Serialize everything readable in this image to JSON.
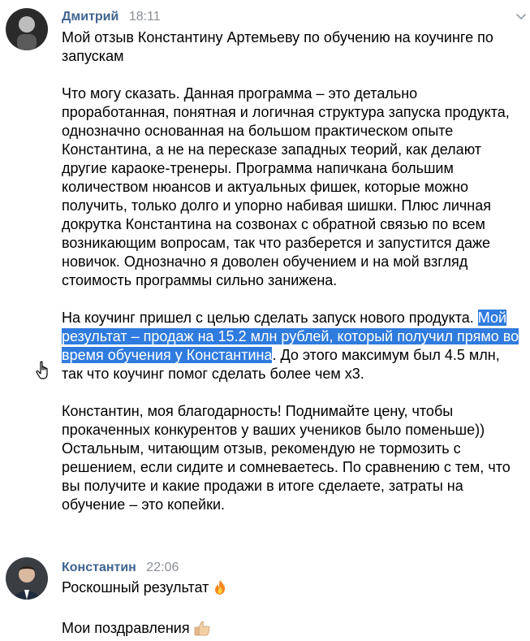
{
  "messages": [
    {
      "author": "Дмитрий",
      "time": "18:11",
      "avatar_icon": "user-photo-dmitry",
      "title_lines": [
        "Мой отзыв Константину Артемьеву по обучению на коучинге по",
        "запускам"
      ],
      "p1_lines": [
        "Что могу сказать. Данная программа – это детально",
        "проработанная, понятная и логичная структура запуска продукта,",
        "однозначно основанная на большом практическом опыте",
        "Константина, а не на пересказе западных теорий, как делают",
        "другие караоке-тренеры. Программа напичкана большим",
        "количеством нюансов и актуальных фишек, которые можно",
        "получить, только долго и упорно набивая шишки. Плюс личная",
        "докрутка Константина на созвонах с обратной связью по всем",
        "возникающим вопросам, так что разберется и запустится даже",
        "новичок. Однозначно я доволен обучением и на мой взгляд",
        "стоимость программы сильно занижена."
      ],
      "p2": {
        "line1_plain": "На коучинг пришел с целью сделать запуск нового продукта. ",
        "line1_highlight": "Мой",
        "line2_highlight": "результат – продаж на 15.2 млн рублей, который получил прямо во",
        "line3_highlight": "время обучения у Константина",
        "line3_plain": ". До этого максимум был 4.5 млн,",
        "line4_plain": "так что коучинг помог сделать более чем х3."
      },
      "p3_lines": [
        "Константин, моя благодарность! Поднимайте цену, чтобы",
        "прокаченных конкурентов у ваших учеников было поменьше))",
        "Остальным, читающим отзыв, рекомендую не тормозить с",
        "решением, если сидите и сомневаетесь. По сравнению с тем, что",
        "вы получите и какие продажи в итоге сделаете, затраты на",
        "обучение – это копейки."
      ]
    },
    {
      "author": "Константин",
      "time": "22:06",
      "avatar_icon": "user-photo-konstantin",
      "line1": "Роскошный результат",
      "line1_emoji": "fire-emoji",
      "line2": "Мои поздравления",
      "line2_emoji": "thumbs-up-emoji"
    }
  ],
  "colors": {
    "author": "#3f6590",
    "time": "#8a8f96",
    "selection": "#2f7bde"
  },
  "icons": {
    "menu": "chevron-down-icon",
    "cursor": "hand-pointer-icon"
  }
}
